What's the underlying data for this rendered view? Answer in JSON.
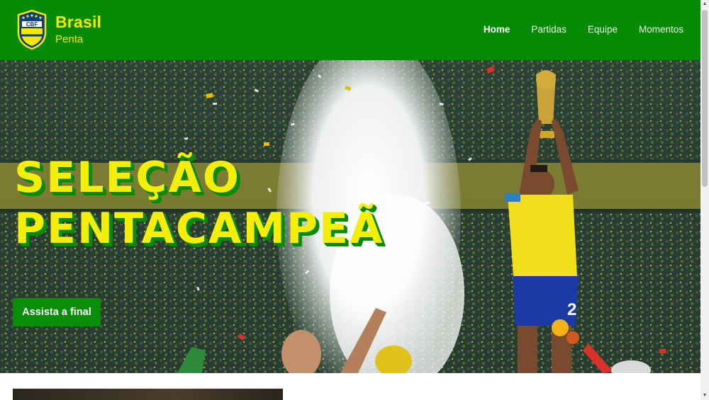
{
  "header": {
    "logo_text": "CBF",
    "brand_title": "Brasil",
    "brand_subtitle": "Penta",
    "nav": [
      "Home",
      "Partidas",
      "Equipe",
      "Momentos"
    ],
    "active_nav": "Home"
  },
  "hero": {
    "title_line1": "SELEÇÃO",
    "title_line2": "PENTACAMPEÃ",
    "cta_label": "Assista a final",
    "jersey_number": "2"
  },
  "colors": {
    "header_bg": "#078b07",
    "brand_yellow": "#f6e800",
    "cta_bg": "#0a8e0a"
  }
}
